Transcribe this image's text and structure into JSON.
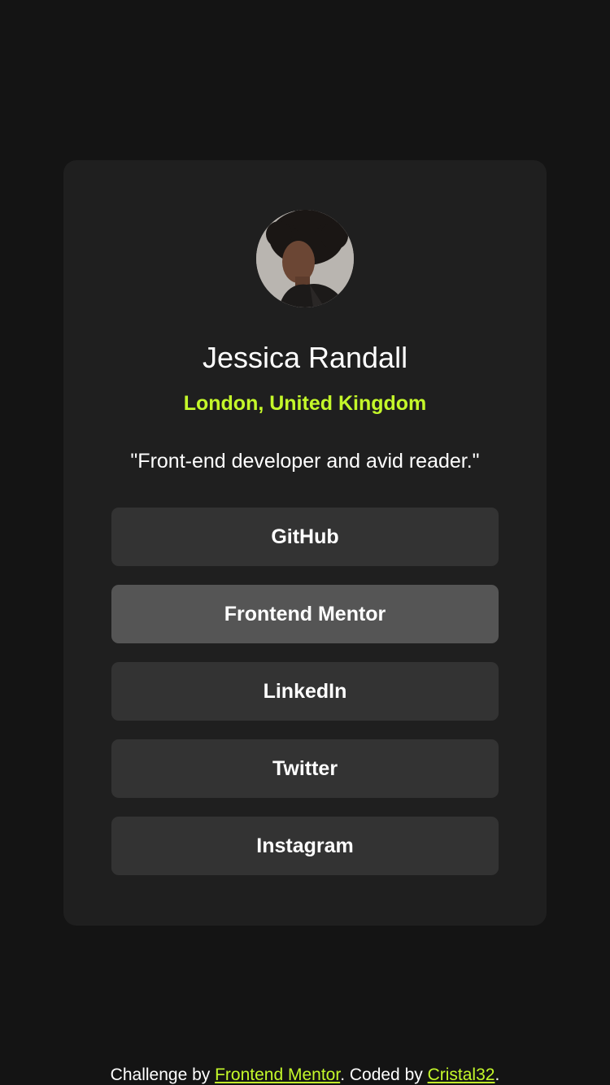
{
  "profile": {
    "name": "Jessica Randall",
    "location": "London, United Kingdom",
    "bio": "\"Front-end developer and avid reader.\""
  },
  "links": [
    {
      "label": "GitHub",
      "state": "default"
    },
    {
      "label": "Frontend Mentor",
      "state": "hover"
    },
    {
      "label": "LinkedIn",
      "state": "default"
    },
    {
      "label": "Twitter",
      "state": "default"
    },
    {
      "label": "Instagram",
      "state": "default"
    }
  ],
  "footer": {
    "prefix": "Challenge by ",
    "challenge_link": "Frontend Mentor",
    "middle": ". Coded by ",
    "author_link": "Cristal32",
    "suffix": "."
  },
  "colors": {
    "background": "#141414",
    "card": "#1f1f1f",
    "button": "#333333",
    "button_hover": "#555555",
    "accent": "#c4f82a",
    "text": "#ffffff"
  }
}
